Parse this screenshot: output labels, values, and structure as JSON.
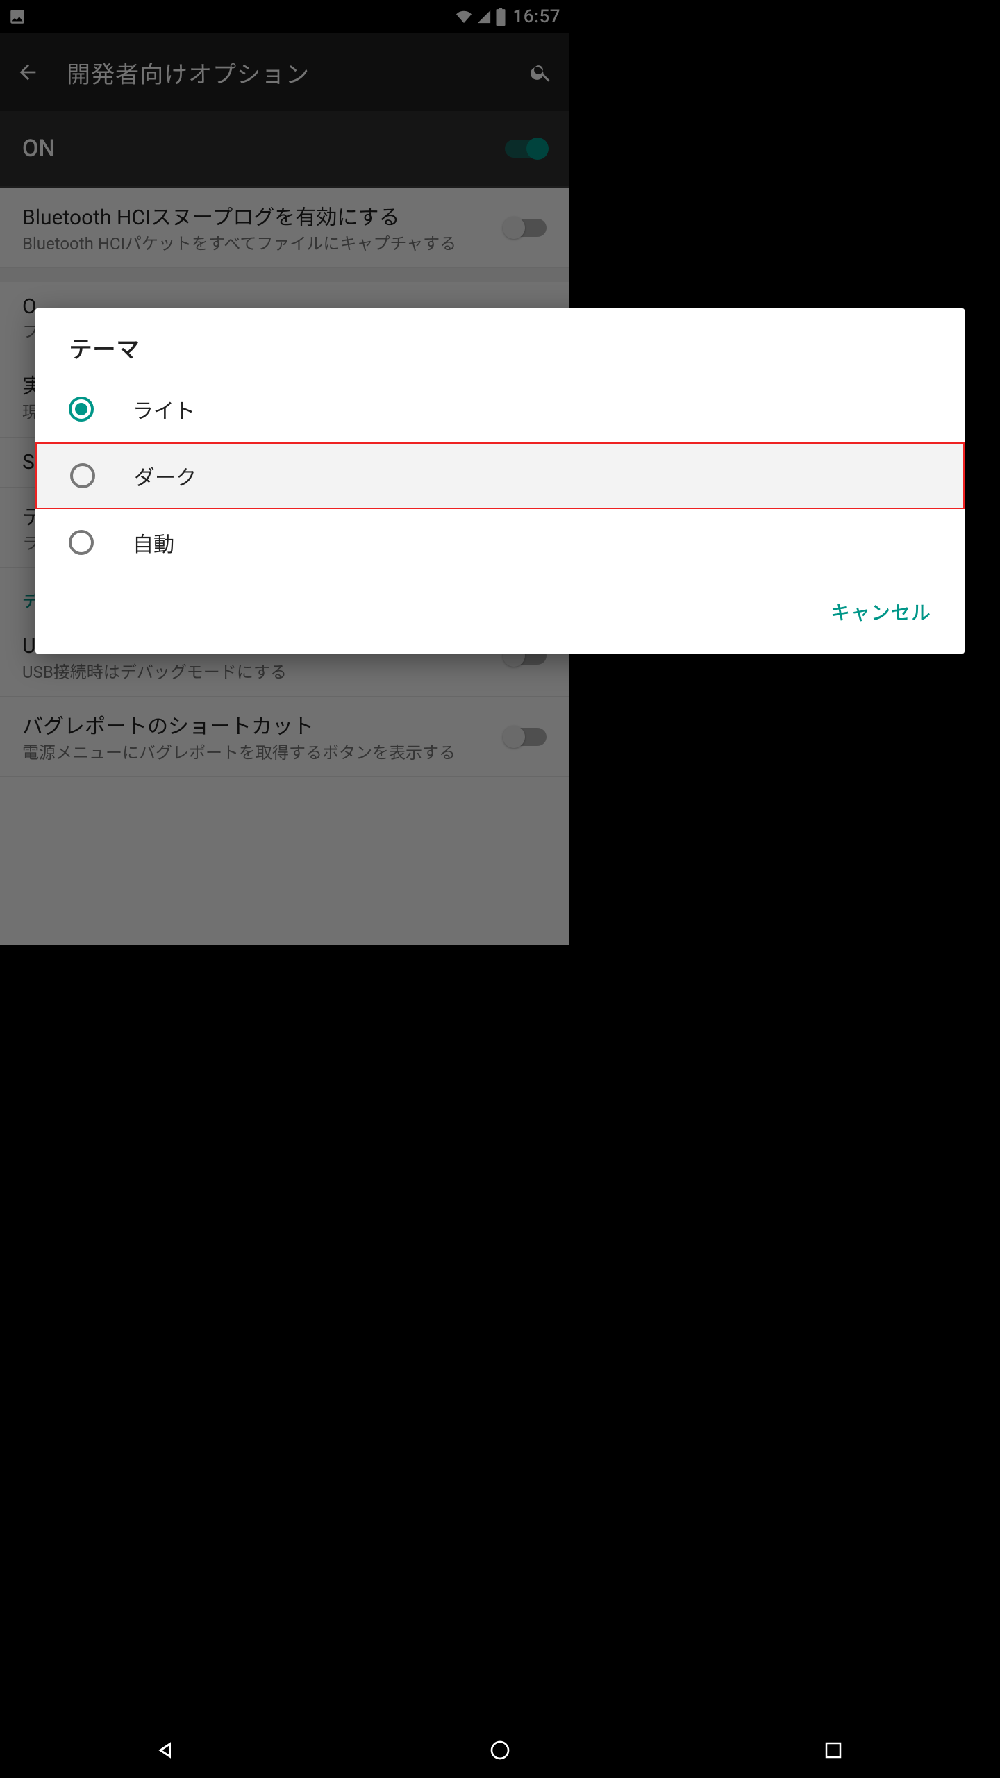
{
  "status": {
    "time": "16:57"
  },
  "header": {
    "title": "開発者向けオプション"
  },
  "master": {
    "on_label": "ON",
    "on_state": true
  },
  "rows": [
    {
      "title": "Bluetooth HCIスヌープログを有効にする",
      "sub": "Bluetooth HCIパケットをすべてファイルにキャプチャする",
      "switch": false
    },
    {
      "title": "O",
      "sub": "フ"
    },
    {
      "title": "実",
      "sub": "現"
    },
    {
      "title": "S"
    },
    {
      "title": "テ",
      "sub": "ラ"
    }
  ],
  "category": {
    "debug": "デバッグ"
  },
  "rows2": [
    {
      "title": "USBデバッグ",
      "sub": "USB接続時はデバッグモードにする",
      "switch": false
    },
    {
      "title": "バグレポートのショートカット",
      "sub": "電源メニューにバグレポートを取得するボタンを表示する",
      "switch": false
    }
  ],
  "dialog": {
    "title": "テーマ",
    "options": [
      {
        "label": "ライト",
        "selected": true,
        "highlight": false
      },
      {
        "label": "ダーク",
        "selected": false,
        "highlight": true
      },
      {
        "label": "自動",
        "selected": false,
        "highlight": false
      }
    ],
    "cancel": "キャンセル"
  }
}
